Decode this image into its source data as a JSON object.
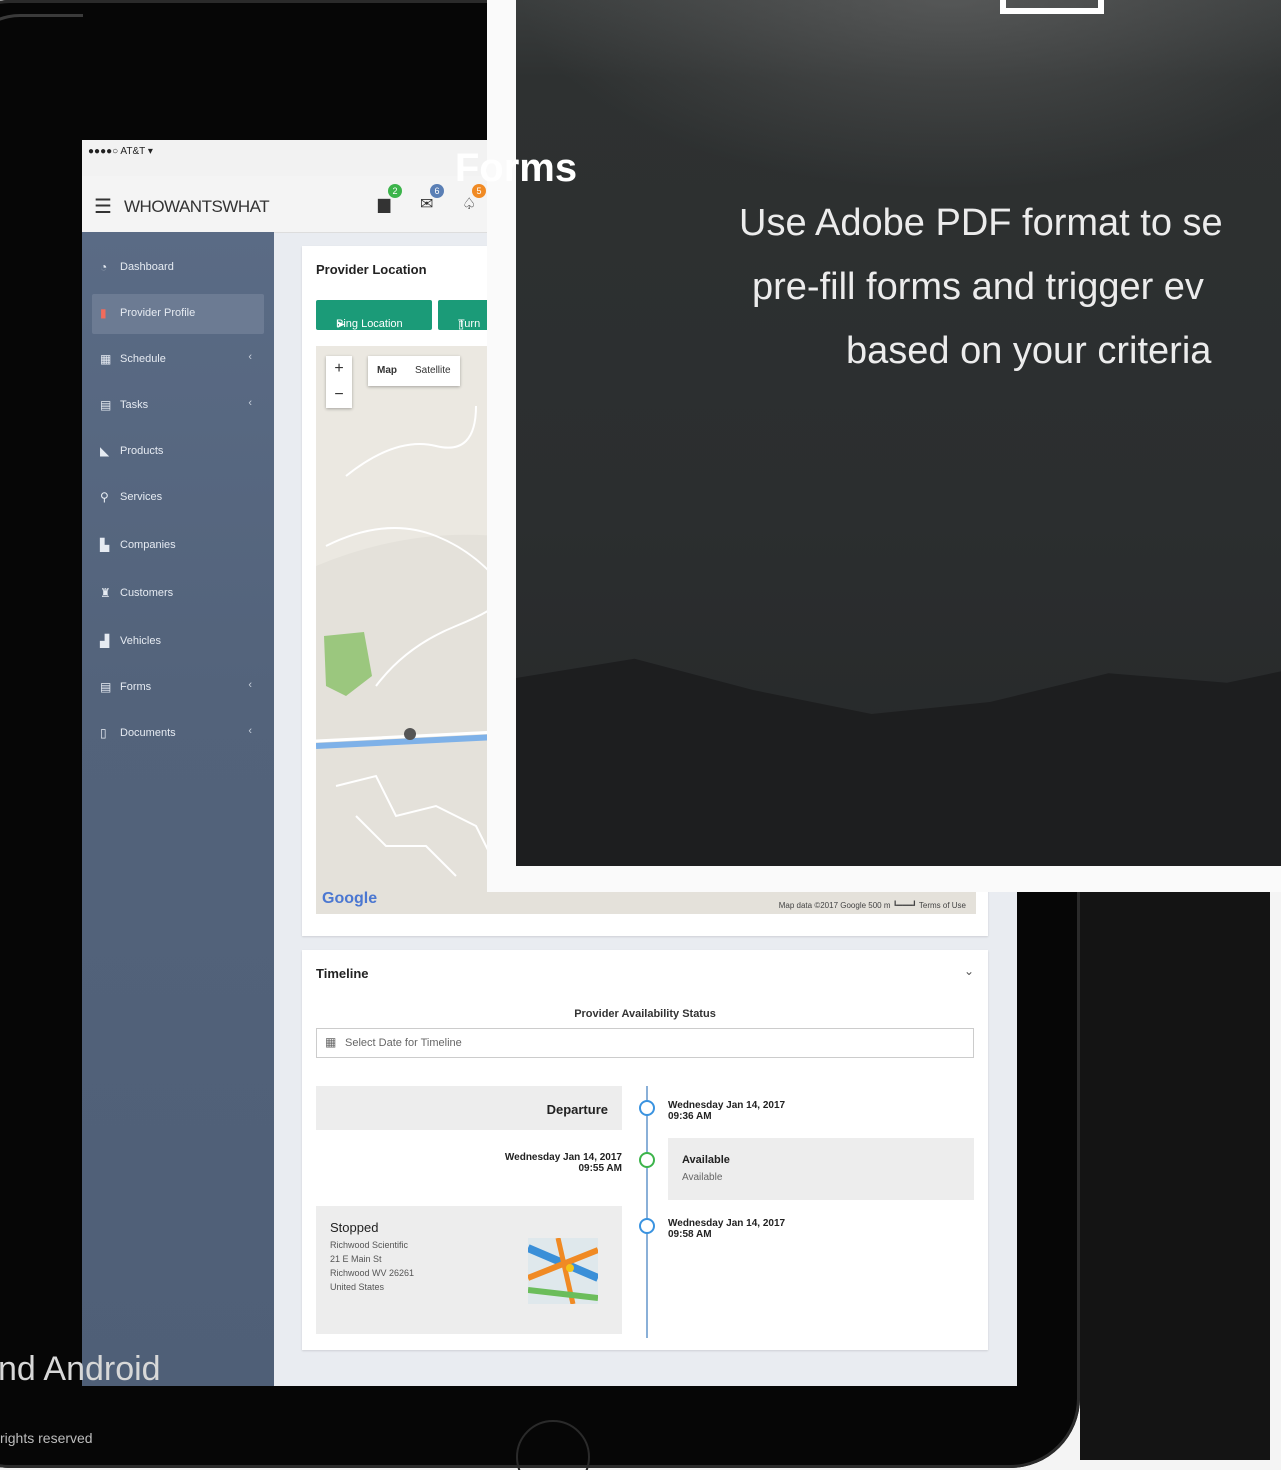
{
  "status_bar": {
    "carrier": "●●●●○ AT&T ▾"
  },
  "app": {
    "brand": "WHOWANTSWHAT",
    "badges": [
      "2",
      "6",
      "5"
    ]
  },
  "sidebar": {
    "items": [
      {
        "label": "Dashboard",
        "icon": "dashboard-icon",
        "chevron": ""
      },
      {
        "label": "Provider Profile",
        "icon": "person-icon",
        "chevron": ""
      },
      {
        "label": "Schedule",
        "icon": "calendar-icon",
        "chevron": "‹"
      },
      {
        "label": "Tasks",
        "icon": "tasks-icon",
        "chevron": "‹"
      },
      {
        "label": "Products",
        "icon": "tag-icon",
        "chevron": ""
      },
      {
        "label": "Services",
        "icon": "wrench-icon",
        "chevron": ""
      },
      {
        "label": "Companies",
        "icon": "building-icon",
        "chevron": ""
      },
      {
        "label": "Customers",
        "icon": "users-icon",
        "chevron": ""
      },
      {
        "label": "Vehicles",
        "icon": "car-icon",
        "chevron": ""
      },
      {
        "label": "Forms",
        "icon": "form-icon",
        "chevron": "‹"
      },
      {
        "label": "Documents",
        "icon": "document-icon",
        "chevron": "‹"
      }
    ]
  },
  "provider_location": {
    "title": "Provider Location",
    "ping_button": "Ping Location",
    "turn_button": "Turn",
    "map_type_map": "Map",
    "map_type_satellite": "Satellite",
    "attribution": "Map data ©2017 Google   500 m ┗━━━┛   Terms of Use",
    "google": "Google"
  },
  "timeline": {
    "title": "Timeline",
    "subtitle": "Provider Availability Status",
    "date_placeholder": "Select Date for Timeline",
    "entries": {
      "departure_label": "Departure",
      "departure_time": "Wednesday Jan 14, 2017 09:36 AM",
      "available_time": "Wednesday Jan 14, 2017 09:55 AM",
      "available_title": "Available",
      "available_sub": "Available",
      "stopped_title": "Stopped",
      "stopped_address": [
        "Richwood Scientific",
        "21 E Main St",
        "Richwood WV 26261",
        "United States"
      ],
      "stopped_time": "Wednesday Jan 14, 2017 09:58 AM"
    }
  },
  "overlay": {
    "title": "Forms",
    "line1": "Use Adobe PDF format to se",
    "line2": "pre-fill forms and trigger ev",
    "line3": "based on your criteria"
  },
  "footer": {
    "platforms": "nd   Android",
    "rights": "rights reserved"
  },
  "colors": {
    "accent_green": "#1b9b78",
    "sidebar_bg": "#55657d",
    "timeline_blue": "#3a93e0",
    "timeline_green": "#3cb44b"
  }
}
